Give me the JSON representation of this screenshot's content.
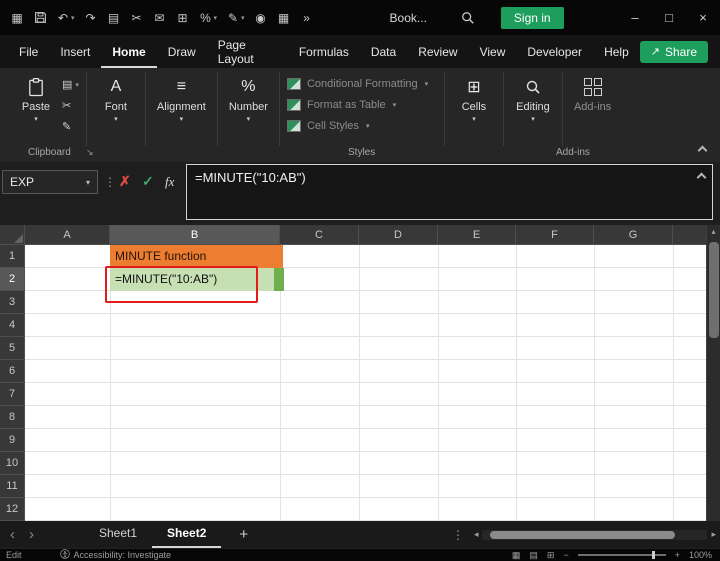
{
  "colors": {
    "accent_green": "#1E9E5C",
    "b1_fill": "#ED7D31",
    "b2_fill": "#C6E0B4",
    "b2_handle": "#6FAF4C",
    "annotation_red": "#E31B1B"
  },
  "glyphs": {
    "chevron_down": "▾",
    "dots_vertical": "⋮",
    "nav_left": "‹",
    "nav_right": "›",
    "scroll_left": "◂",
    "scroll_right": "▸",
    "scroll_up": "▴",
    "plus": "+",
    "minus": "−",
    "window_minimize": "–",
    "window_maximize": "□",
    "window_close": "×",
    "cancel": "✗",
    "check": "✓",
    "more": "»",
    "share_arrow": "↗",
    "dialog_launcher": "↘"
  },
  "title_bar": {
    "workbook_name": "Book...",
    "sign_in_label": "Sign in",
    "icons": [
      {
        "name": "app-grid-icon",
        "glyph": "▦"
      },
      {
        "name": "undo-icon",
        "glyph": "↶"
      },
      {
        "name": "redo-icon",
        "glyph": "↷"
      },
      {
        "name": "copy-icon",
        "glyph": "▤"
      },
      {
        "name": "cut-icon",
        "glyph": "✂"
      },
      {
        "name": "mail-icon",
        "glyph": "✉"
      },
      {
        "name": "table-icon",
        "glyph": "⊞"
      },
      {
        "name": "percent-icon",
        "glyph": "%"
      },
      {
        "name": "format-painter-icon",
        "glyph": "✎"
      },
      {
        "name": "camera-icon",
        "glyph": "◉"
      },
      {
        "name": "grid-icon",
        "glyph": "▦"
      }
    ]
  },
  "menu": {
    "tabs": [
      {
        "label": "File"
      },
      {
        "label": "Insert"
      },
      {
        "label": "Home"
      },
      {
        "label": "Draw"
      },
      {
        "label": "Page Layout"
      },
      {
        "label": "Formulas"
      },
      {
        "label": "Data"
      },
      {
        "label": "Review"
      },
      {
        "label": "View"
      },
      {
        "label": "Developer"
      },
      {
        "label": "Help"
      }
    ],
    "active_tab": "Home",
    "share_label": "Share"
  },
  "ribbon": {
    "paste_label": "Paste",
    "clipboard_group_label": "Clipboard",
    "mini_icons": [
      {
        "name": "copy-icon",
        "glyph": "▤"
      },
      {
        "name": "cut-icon",
        "glyph": "✂"
      },
      {
        "name": "format-painter-icon",
        "glyph": "✎"
      }
    ],
    "font_label": "Font",
    "font_icon": "A",
    "alignment_label": "Alignment",
    "alignment_icon": "≡",
    "number_label": "Number",
    "number_icon": "%",
    "styles": {
      "conditional_formatting_label": "Conditional Formatting",
      "format_as_table_label": "Format as Table",
      "cell_styles_label": "Cell Styles",
      "group_label": "Styles"
    },
    "cells_label": "Cells",
    "cells_icon": "⊞",
    "editing_label": "Editing",
    "addins_label": "Add-ins",
    "addins_group_label": "Add-ins"
  },
  "formula_bar": {
    "name_box_value": "EXP",
    "fx_label": "fx",
    "formula": "=MINUTE(\"10:AB\")"
  },
  "grid": {
    "columns": [
      "A",
      "B",
      "C",
      "D",
      "E",
      "F",
      "G"
    ],
    "rows": [
      "1",
      "2",
      "3",
      "4",
      "5",
      "6",
      "7",
      "8",
      "9",
      "10",
      "11",
      "12"
    ],
    "b1_text": "MINUTE function",
    "b2_text": "=MINUTE(\"10:AB\")",
    "selected_column": "B",
    "selected_row": "2"
  },
  "sheet_bar": {
    "tabs": [
      {
        "label": "Sheet1"
      },
      {
        "label": "Sheet2"
      }
    ],
    "active_tab": "Sheet2"
  },
  "status_bar": {
    "mode_label": "Edit",
    "accessibility_label": "Accessibility: Investigate",
    "zoom_label": "100%"
  }
}
